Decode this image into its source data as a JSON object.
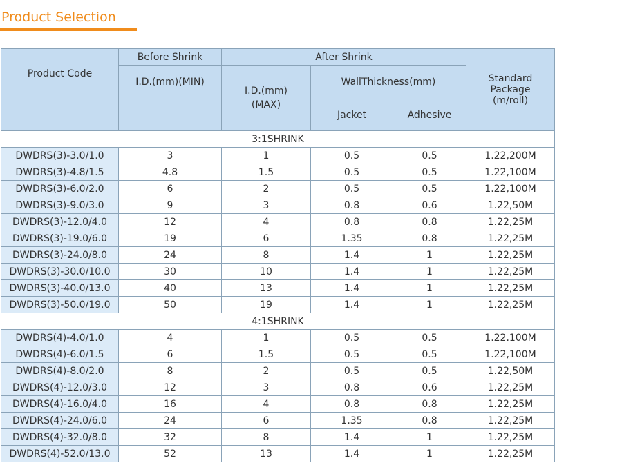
{
  "heading": "Product Selection",
  "header": {
    "product_code": "Product Code",
    "before_shrink": "Before Shrink",
    "after_shrink": "After Shrink",
    "id_min": "I.D.(mm)(MIN)",
    "id_max_line1": "I.D.(mm)",
    "id_max_line2": "(MAX)",
    "wall_thickness": "WallThickness(mm)",
    "jacket": "Jacket",
    "adhesive": "Adhesive",
    "standard_line1": "Standard",
    "standard_line2": "Package",
    "standard_line3": "(m/roll)"
  },
  "sections": [
    {
      "title": "3:1SHRINK",
      "rows": [
        [
          "DWDRS(3)-3.0/1.0",
          "3",
          "1",
          "0.5",
          "0.5",
          "1.22,200M"
        ],
        [
          "DWDRS(3)-4.8/1.5",
          "4.8",
          "1.5",
          "0.5",
          "0.5",
          "1.22,100M"
        ],
        [
          "DWDRS(3)-6.0/2.0",
          "6",
          "2",
          "0.5",
          "0.5",
          "1.22,100M"
        ],
        [
          "DWDRS(3)-9.0/3.0",
          "9",
          "3",
          "0.8",
          "0.6",
          "1.22,50M"
        ],
        [
          "DWDRS(3)-12.0/4.0",
          "12",
          "4",
          "0.8",
          "0.8",
          "1.22,25M"
        ],
        [
          "DWDRS(3)-19.0/6.0",
          "19",
          "6",
          "1.35",
          "0.8",
          "1.22,25M"
        ],
        [
          "DWDRS(3)-24.0/8.0",
          "24",
          "8",
          "1.4",
          "1",
          "1.22,25M"
        ],
        [
          "DWDRS(3)-30.0/10.0",
          "30",
          "10",
          "1.4",
          "1",
          "1.22,25M"
        ],
        [
          "DWDRS(3)-40.0/13.0",
          "40",
          "13",
          "1.4",
          "1",
          "1.22,25M"
        ],
        [
          "DWDRS(3)-50.0/19.0",
          "50",
          "19",
          "1.4",
          "1",
          "1.22,25M"
        ]
      ]
    },
    {
      "title": "4:1SHRINK",
      "rows": [
        [
          "DWDRS(4)-4.0/1.0",
          "4",
          "1",
          "0.5",
          "0.5",
          "1.22.100M"
        ],
        [
          "DWDRS(4)-6.0/1.5",
          "6",
          "1.5",
          "0.5",
          "0.5",
          "1.22,100M"
        ],
        [
          "DWDRS(4)-8.0/2.0",
          "8",
          "2",
          "0.5",
          "0.5",
          "1.22,50M"
        ],
        [
          "DWDRS(4)-12.0/3.0",
          "12",
          "3",
          "0.8",
          "0.6",
          "1.22,25M"
        ],
        [
          "DWDRS(4)-16.0/4.0",
          "16",
          "4",
          "0.8",
          "0.8",
          "1.22,25M"
        ],
        [
          "DWDRS(4)-24.0/6.0",
          "24",
          "6",
          "1.35",
          "0.8",
          "1.22,25M"
        ],
        [
          "DWDRS(4)-32.0/8.0",
          "32",
          "8",
          "1.4",
          "1",
          "1.22,25M"
        ],
        [
          "DWDRS(4)-52.0/13.0",
          "52",
          "13",
          "1.4",
          "1",
          "1.22,25M"
        ]
      ]
    }
  ],
  "colors": {
    "accent": "#f08c1c",
    "header_bg": "#c5dcf1",
    "code_cell_bg": "#dcebf8",
    "border": "#8aa3b8"
  }
}
